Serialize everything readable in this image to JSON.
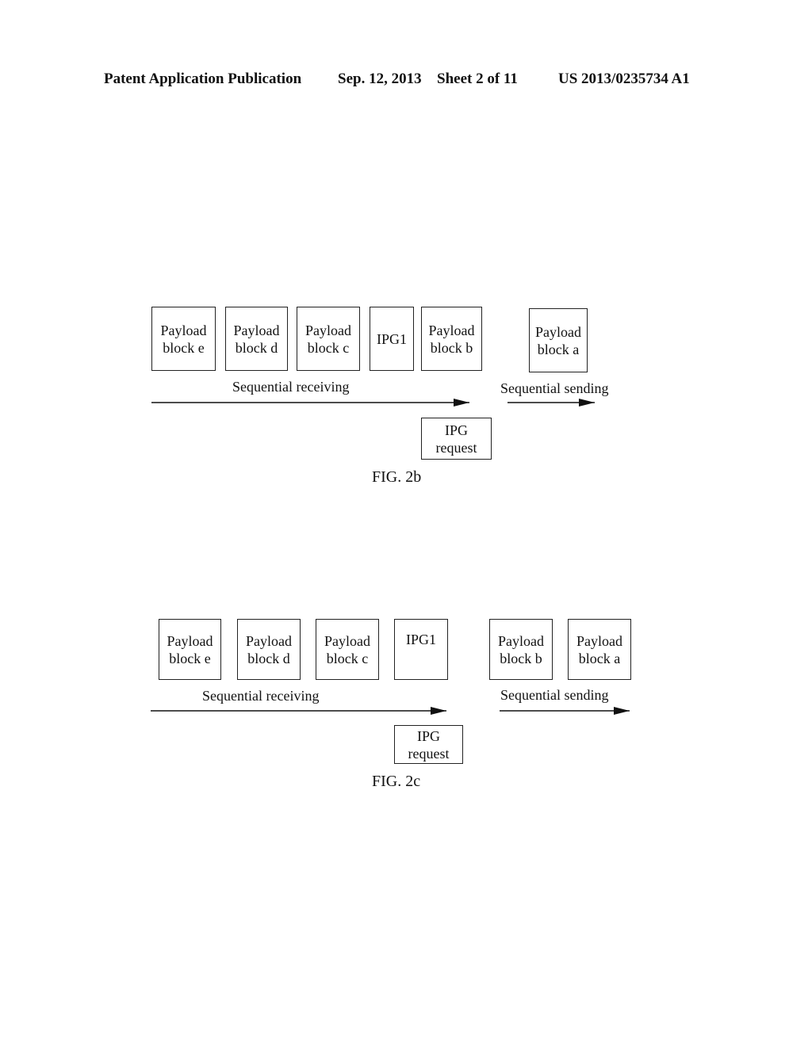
{
  "header": {
    "left": "Patent Application Publication",
    "date": "Sep. 12, 2013",
    "sheet": "Sheet 2 of 11",
    "number": "US 2013/0235734 A1"
  },
  "fig2b": {
    "blocks": [
      {
        "line1": "Payload",
        "line2": "block e"
      },
      {
        "line1": "Payload",
        "line2": "block d"
      },
      {
        "line1": "Payload",
        "line2": "block c"
      },
      {
        "line1": "IPG1",
        "line2": ""
      },
      {
        "line1": "Payload",
        "line2": "block b"
      },
      {
        "line1": "Payload",
        "line2": "block a"
      }
    ],
    "receiving_label": "Sequential receiving",
    "sending_label": "Sequential sending",
    "request": {
      "line1": "IPG",
      "line2": "request"
    },
    "caption": "FIG. 2b"
  },
  "fig2c": {
    "blocks": [
      {
        "line1": "Payload",
        "line2": "block e"
      },
      {
        "line1": "Payload",
        "line2": "block d"
      },
      {
        "line1": "Payload",
        "line2": "block c"
      },
      {
        "line1": "IPG1",
        "line2": ""
      },
      {
        "line1": "Payload",
        "line2": "block b"
      },
      {
        "line1": "Payload",
        "line2": "block a"
      }
    ],
    "receiving_label": "Sequential receiving",
    "sending_label": "Sequential sending",
    "request": {
      "line1": "IPG",
      "line2": "request"
    },
    "caption": "FIG. 2c"
  }
}
